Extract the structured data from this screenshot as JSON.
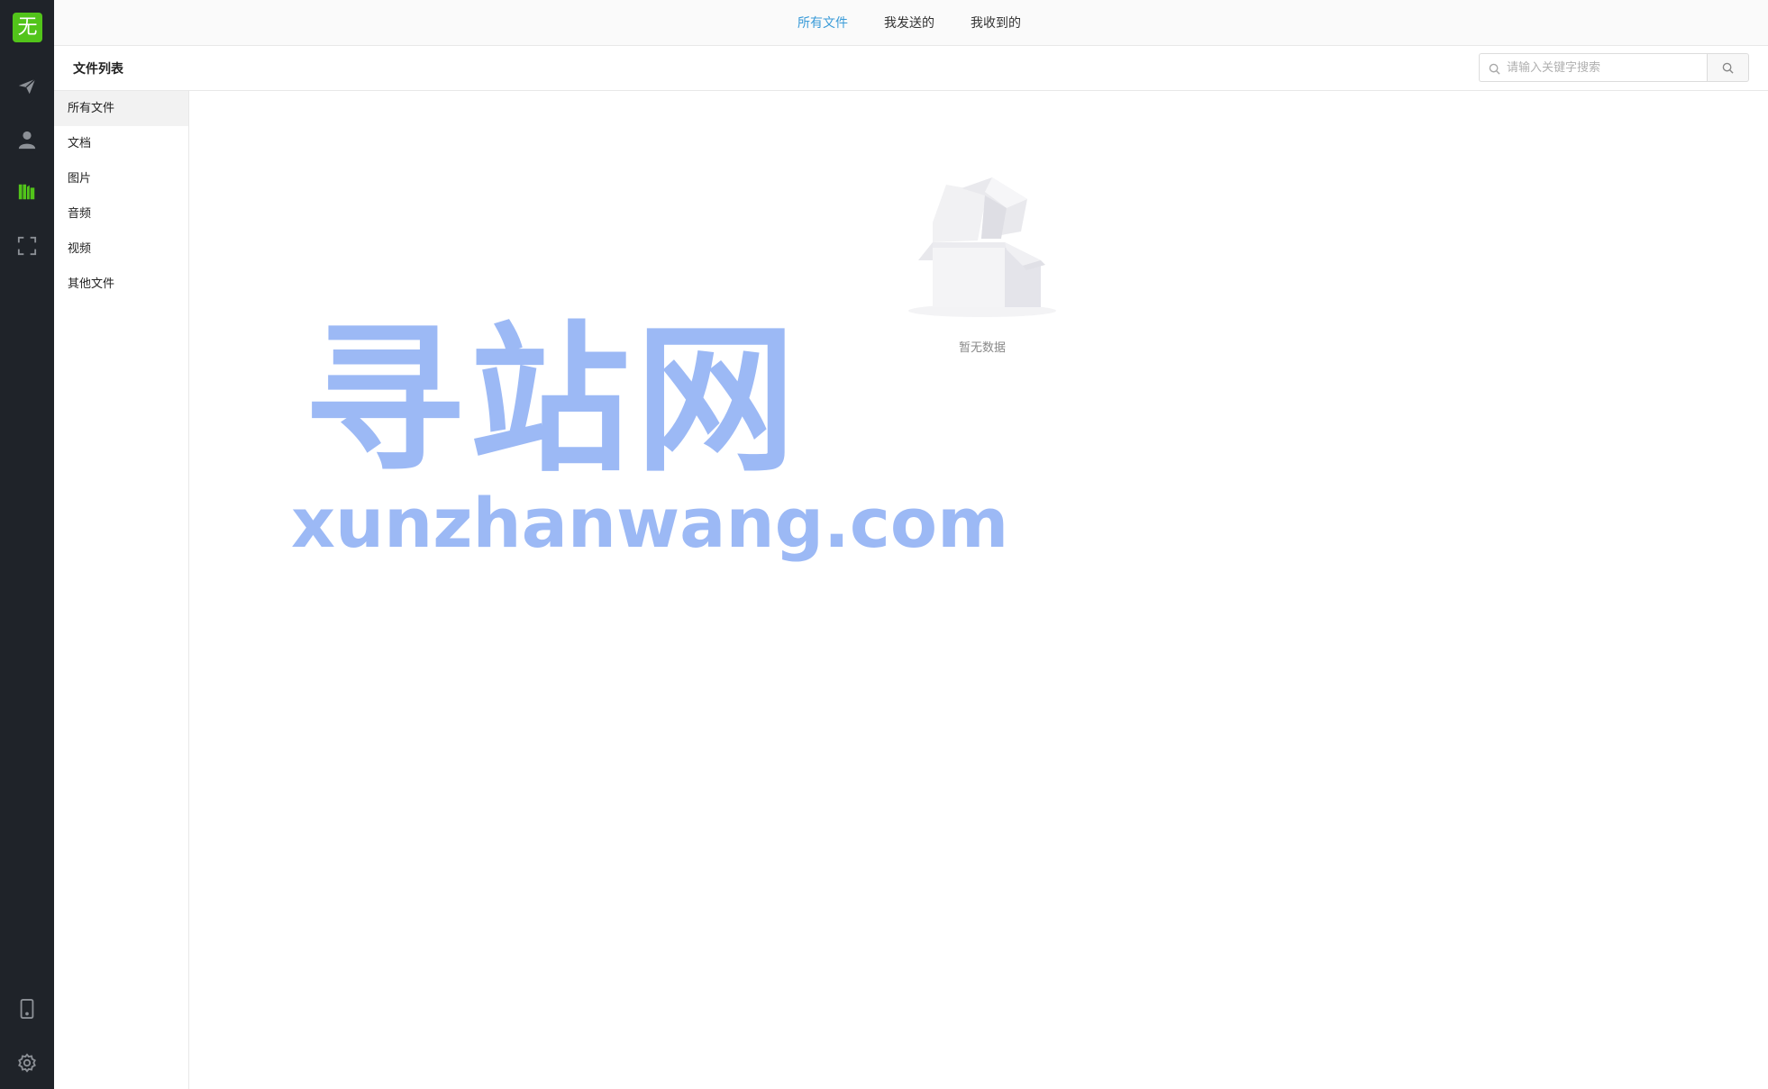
{
  "app": {
    "logo_char": "无",
    "accent_color": "#52c41a",
    "link_color": "#3a9bd8"
  },
  "rail": {
    "icons": [
      "send-icon",
      "contacts-icon",
      "files-icon",
      "scan-icon",
      "mobile-icon",
      "settings-icon"
    ],
    "active": "files-icon"
  },
  "topbar": {
    "tabs": [
      {
        "label": "所有文件",
        "active": true
      },
      {
        "label": "我发送的",
        "active": false
      },
      {
        "label": "我收到的",
        "active": false
      }
    ]
  },
  "header": {
    "title": "文件列表"
  },
  "search": {
    "placeholder": "请输入关键字搜索",
    "value": ""
  },
  "categories": [
    {
      "label": "所有文件",
      "active": true
    },
    {
      "label": "文档",
      "active": false
    },
    {
      "label": "图片",
      "active": false
    },
    {
      "label": "音频",
      "active": false
    },
    {
      "label": "视频",
      "active": false
    },
    {
      "label": "其他文件",
      "active": false
    }
  ],
  "empty_state": {
    "text": "暂无数据"
  },
  "watermark": {
    "cn": "寻站网",
    "en": "xunzhanwang.com"
  }
}
